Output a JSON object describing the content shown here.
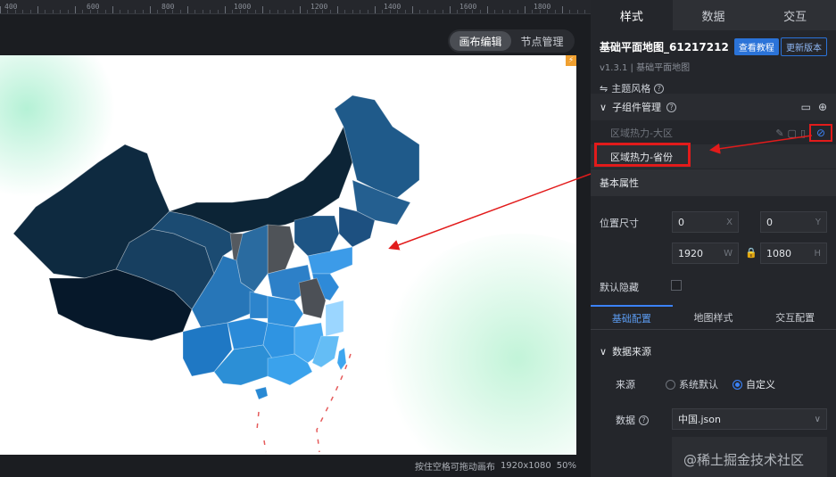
{
  "ruler": {
    "ticks": [
      "400",
      "600",
      "800",
      "1000",
      "1200",
      "1400",
      "1600",
      "1800"
    ]
  },
  "view_toggle": {
    "canvas_edit": "画布编辑",
    "node_manage": "节点管理"
  },
  "status": {
    "hint": "按住空格可拖动画布",
    "resolution": "1920x1080",
    "zoom": "50%"
  },
  "panel": {
    "tabs": [
      "样式",
      "数据",
      "交互"
    ],
    "component": {
      "name": "基础平面地图_61217212",
      "view_tutorial": "查看教程",
      "update_version": "更新版本",
      "subtitle": "v1.3.1 | 基础平面地图",
      "theme": "主题风格"
    },
    "sub_components": {
      "title": "子组件管理",
      "items": [
        "区域热力-大区",
        "区域热力-省份"
      ]
    },
    "basic_props": {
      "title": "基本属性",
      "position_size": "位置尺寸",
      "x": "0",
      "x_unit": "X",
      "y": "0",
      "y_unit": "Y",
      "w": "1920",
      "w_unit": "W",
      "h": "1080",
      "h_unit": "H",
      "default_hidden": "默认隐藏"
    },
    "config_tabs": [
      "基础配置",
      "地图样式",
      "交互配置"
    ],
    "data_source": {
      "title": "数据来源",
      "source_label": "来源",
      "opt_default": "系统默认",
      "opt_custom": "自定义",
      "data_label": "数据",
      "data_value": "中国.json"
    }
  },
  "watermark": "@稀土掘金技术社区",
  "colors": {
    "accent": "#3b82f6",
    "annotation": "#e21b1b"
  }
}
